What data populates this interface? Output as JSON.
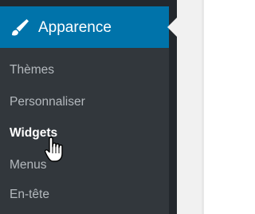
{
  "menu": {
    "label": "Apparence",
    "icon": "paintbrush-icon",
    "highlight_color": "#0073aa",
    "submenu": [
      {
        "label": "Thèmes",
        "current": false
      },
      {
        "label": "Personnaliser",
        "current": false
      },
      {
        "label": "Widgets",
        "current": true
      },
      {
        "label": "Menus",
        "current": false
      },
      {
        "label": "En-tête",
        "current": false
      }
    ]
  },
  "cursor": "hand-pointer-icon"
}
